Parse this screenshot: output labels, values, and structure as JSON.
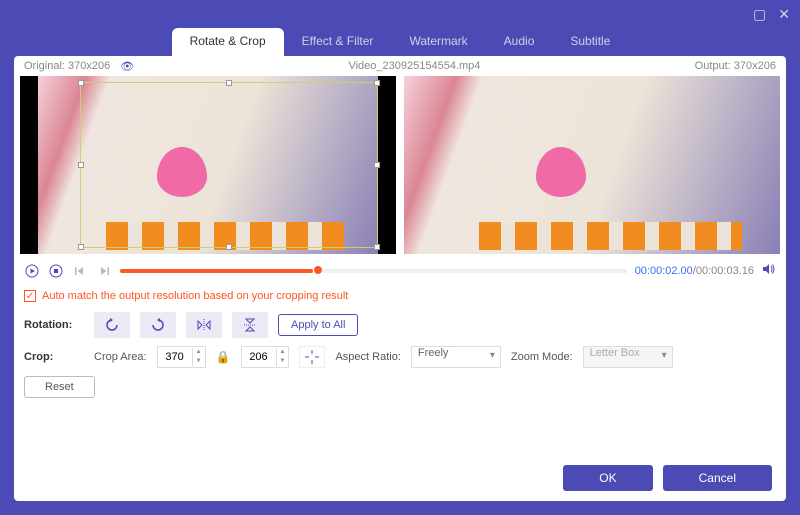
{
  "titlebar": {
    "minimize": "▢",
    "close": "✕"
  },
  "tabs": {
    "items": [
      {
        "label": "Rotate & Crop",
        "active": true
      },
      {
        "label": "Effect & Filter"
      },
      {
        "label": "Watermark"
      },
      {
        "label": "Audio"
      },
      {
        "label": "Subtitle"
      }
    ]
  },
  "info": {
    "original_label": "Original:",
    "original_res": "370x206",
    "filename": "Video_230925154554.mp4",
    "output_label": "Output:",
    "output_res": "370x206"
  },
  "playback": {
    "current": "00:00:02.00",
    "sep": "/",
    "duration": "00:00:03.16"
  },
  "automatch": {
    "label": "Auto match the output resolution based on your cropping result",
    "checked": "✓"
  },
  "rotation": {
    "label": "Rotation:",
    "apply_all": "Apply to All"
  },
  "crop": {
    "label": "Crop:",
    "area_label": "Crop Area:",
    "width": "370",
    "height": "206",
    "aspect_label": "Aspect Ratio:",
    "aspect_value": "Freely",
    "zoom_label": "Zoom Mode:",
    "zoom_value": "Letter Box",
    "reset": "Reset"
  },
  "footer": {
    "ok": "OK",
    "cancel": "Cancel"
  }
}
